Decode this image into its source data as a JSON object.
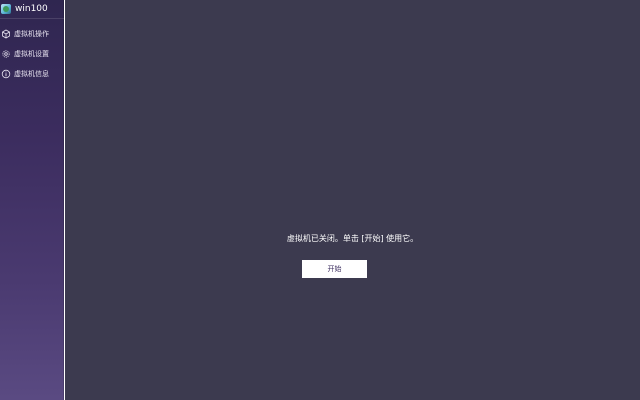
{
  "sidebar": {
    "vm_name": "win100",
    "items": [
      {
        "label": "虚拟机操作",
        "icon": "cube-icon"
      },
      {
        "label": "虚拟机设置",
        "icon": "gear-icon"
      },
      {
        "label": "虚拟机信息",
        "icon": "info-icon"
      }
    ]
  },
  "main": {
    "status_message": "虚拟机已关闭。单击 [开始] 使用它。",
    "start_button_label": "开始"
  },
  "colors": {
    "main_background": "#3c3a4f",
    "sidebar_top": "#2f2650",
    "sidebar_bottom": "#5a4a82",
    "button_background": "#ffffff",
    "button_text": "#3c2d5f"
  }
}
